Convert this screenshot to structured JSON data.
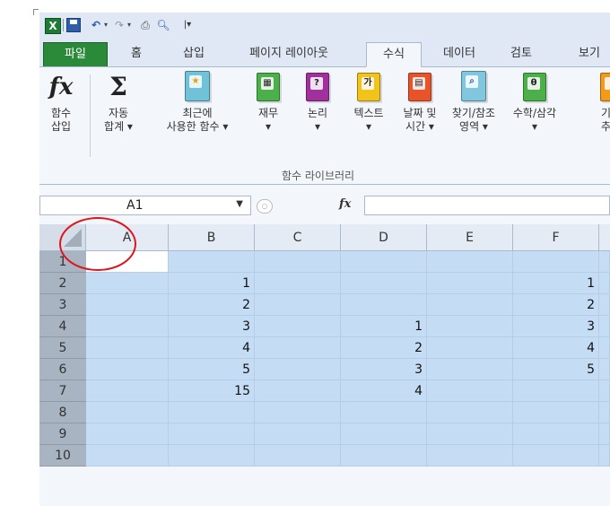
{
  "qat": {
    "undo_glyph": "↶",
    "redo_glyph": "↷",
    "dropdown_glyph": "▾",
    "more_glyph": "|▾"
  },
  "tabs": [
    "파일",
    "홈",
    "삽입",
    "페이지 레이아웃",
    "수식",
    "데이터",
    "검토",
    "보기"
  ],
  "active_tab": "수식",
  "ribbon": {
    "buttons": [
      {
        "icon": "fx-icon",
        "label1": "함수",
        "label2": "삽입"
      },
      {
        "icon": "sigma-icon",
        "label1": "자동",
        "label2": "합계 ▾"
      },
      {
        "icon": "star-book-icon",
        "label1": "최근에",
        "label2": "사용한 함수 ▾"
      },
      {
        "icon": "finance-book-icon",
        "label1": "재무",
        "label2": "▾"
      },
      {
        "icon": "logic-book-icon",
        "label1": "논리",
        "label2": "▾"
      },
      {
        "icon": "text-book-icon",
        "label1": "텍스트",
        "label2": "▾"
      },
      {
        "icon": "datetime-book-icon",
        "label1": "날짜 및",
        "label2": "시간 ▾"
      },
      {
        "icon": "lookup-book-icon",
        "label1": "찾기/참조",
        "label2": "영역 ▾"
      },
      {
        "icon": "math-book-icon",
        "label1": "수학/삼각",
        "label2": "▾"
      },
      {
        "icon": "more-book-icon",
        "label1": "기",
        "label2": "추"
      }
    ],
    "icon_text": {
      "logic": "?",
      "text": "가",
      "math": "θ"
    },
    "group_label": "함수 라이브러리"
  },
  "formula_bar": {
    "name_box": "A1",
    "fx": "fx",
    "formula": ""
  },
  "grid": {
    "columns": [
      "A",
      "B",
      "C",
      "D",
      "E",
      "F"
    ],
    "rows": [
      "1",
      "2",
      "3",
      "4",
      "5",
      "6",
      "7",
      "8",
      "9",
      "10"
    ],
    "cells": {
      "B": [
        "",
        "1",
        "2",
        "3",
        "4",
        "5",
        "15",
        "",
        "",
        ""
      ],
      "D": [
        "",
        "",
        "",
        "1",
        "2",
        "3",
        "4",
        "",
        "",
        ""
      ],
      "F": [
        "",
        "1",
        "2",
        "3",
        "4",
        "5",
        "",
        "",
        "",
        ""
      ]
    }
  },
  "colors": {
    "selection": "#c5dcf5",
    "annotation": "#e0141c",
    "file_tab": "#2a8a3a"
  }
}
